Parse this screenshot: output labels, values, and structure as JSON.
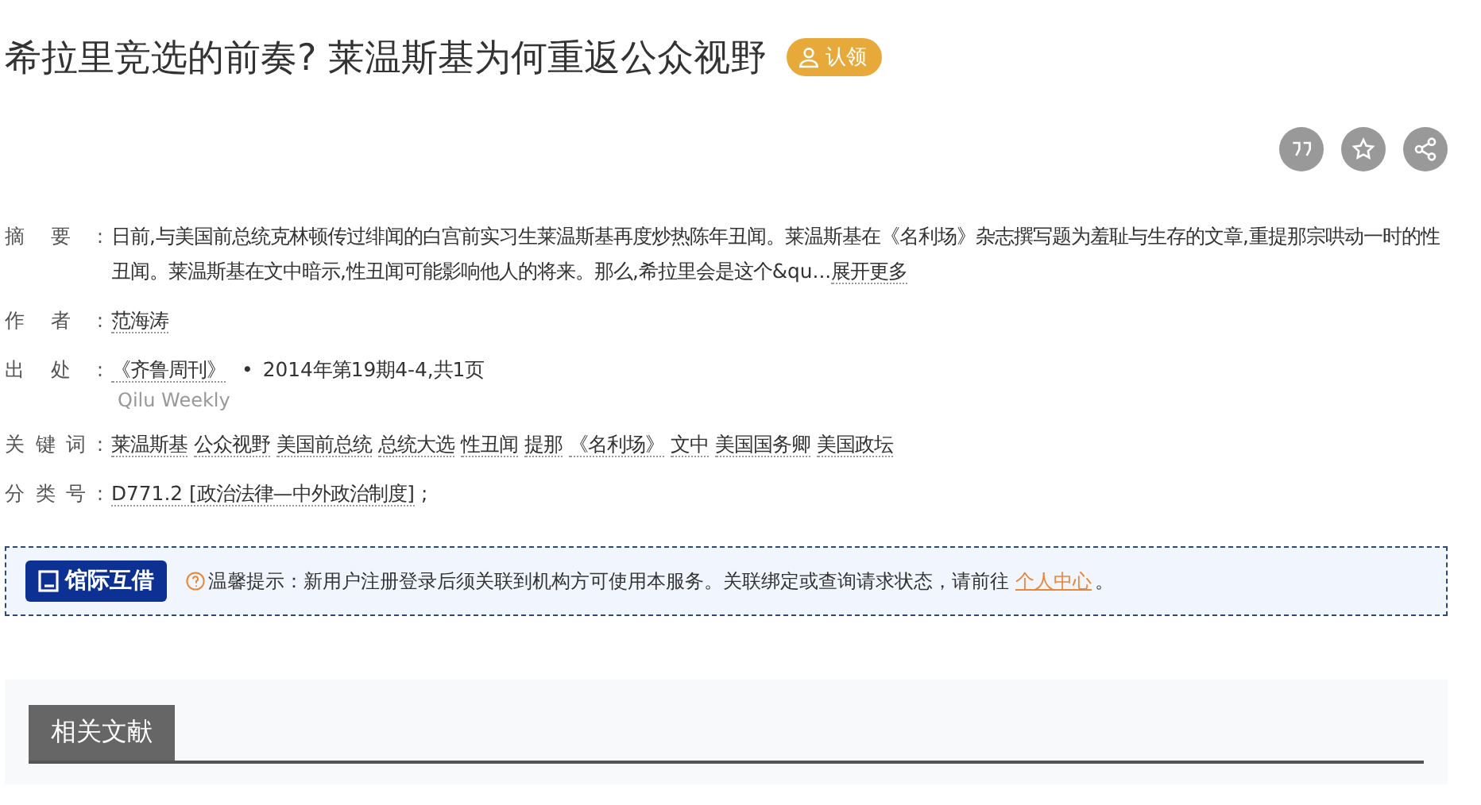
{
  "title": "希拉里竞选的前奏? 莱温斯基为何重返公众视野",
  "claim_badge": "认领",
  "actions": [
    {
      "kind": "quote"
    },
    {
      "kind": "favorite"
    },
    {
      "kind": "share"
    }
  ],
  "meta": [
    {
      "kind": "abstract",
      "label": "摘要:",
      "text": "日前,与美国前总统克林顿传过绯闻的白宫前实习生莱温斯基再度炒热陈年丑闻。莱温斯基在《名利场》杂志撰写题为羞耻与生存的文章,重提那宗哄动一时的性丑闻。莱温斯基在文中暗示,性丑闻可能影响他人的将来。那么,希拉里会是这个&qu...",
      "link": "展开更多"
    },
    {
      "kind": "links",
      "label": "作者:",
      "links": [
        "范海涛"
      ]
    },
    {
      "kind": "source",
      "label": "出处:",
      "journal": "《齐鲁周刊》",
      "bullet": "•",
      "issue": "2014年第19期4-4,共1页",
      "subtitle": "Qilu Weekly"
    },
    {
      "kind": "links",
      "label": "关键词:",
      "links": [
        "莱温斯基",
        "公众视野",
        "美国前总统",
        "总统大选",
        "性丑闻",
        "提那",
        "《名利场》",
        "文中",
        "美国国务卿",
        "美国政坛"
      ]
    },
    {
      "kind": "links",
      "label": "分类号:",
      "links": [
        "D771.2 [政治法律—中外政治制度]"
      ],
      "suffix": ";"
    }
  ],
  "loan": {
    "button": "馆际互借",
    "notice": "温馨提示：新用户注册登录后须关联到机构方可使用本服务。关联绑定或查询请求状态，请前往",
    "link": "个人中心",
    "end": "。"
  },
  "related": {
    "tab": "相关文献"
  }
}
